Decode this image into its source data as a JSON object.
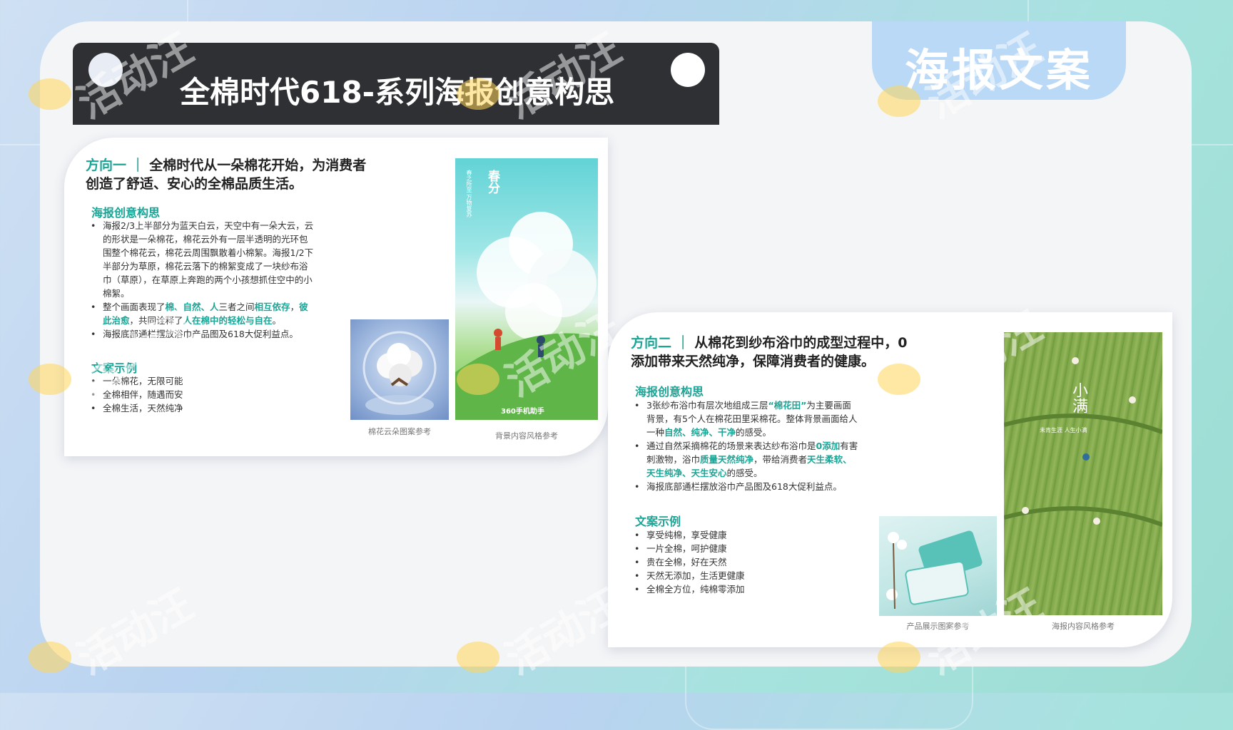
{
  "page": {
    "title": "全棉时代618-系列海报创意构思",
    "tab_label": "海报文案",
    "watermark": "活动汪"
  },
  "card1": {
    "direction_label": "方向一 ｜",
    "direction_text": "全棉时代从一朵棉花开始，为消费者创造了舒适、安心的全棉品质生活。",
    "concept_title": "海报创意构思",
    "concept_p1": "海报2/3上半部分为蓝天白云，天空中有一朵大云，云的形状是一朵棉花，棉花云外有一层半透明的光环包围整个棉花云，棉花云周围飘散着小棉絮。海报1/2下半部分为草原，棉花云落下的棉絮变成了一块纱布浴巾（草原），在草原上奔跑的两个小孩想抓住空中的小棉絮。",
    "concept_p2": {
      "t1": "整个画面表现了",
      "h1": "棉、自然、人",
      "t2": "三者之间",
      "h2": "相互依存",
      "t3": "，",
      "h3": "彼此治愈",
      "t4": "，共同诠释了",
      "h4": "人在棉中的轻松与自在",
      "t5": "。"
    },
    "concept_p3": "海报底部通栏摆放浴巾产品图及618大促利益点。",
    "copy_title": "文案示例",
    "copy_items": [
      "一朵棉花，无限可能",
      "全棉相伴，随遇而安",
      "全棉生活，天然纯净"
    ],
    "caption_left": "棉花云朵图案参考",
    "caption_right": "背景内容风格参考",
    "poster": {
      "title": "春分",
      "subtitle": "春之所至 万物复苏",
      "brand": "360手机助手"
    }
  },
  "card2": {
    "direction_label": "方向二 ｜",
    "direction_text": "从棉花到纱布浴巾的成型过程中，0添加带来天然纯净，保障消费者的健康。",
    "concept_title": "海报创意构思",
    "concept_p1": {
      "t1": "3张纱布浴巾有层次地组成三层",
      "h1": "“棉花田”",
      "t2": "为主要画面背景，有5个人在棉花田里采棉花。整体背景画面给人一种",
      "h2": "自然、纯净、干净",
      "t3": "的感受。"
    },
    "concept_p2": {
      "t1": "通过自然采摘棉花的场景来表达纱布浴巾是",
      "h1": "0添加",
      "t2": "有害刺激物，浴巾",
      "h2": "质量天然纯净",
      "t3": "，带给消费者",
      "h3": "天生柔软、天生纯净、天生安心",
      "t4": "的感受。"
    },
    "concept_p3": "海报底部通栏摆放浴巾产品图及618大促利益点。",
    "copy_title": "文案示例",
    "copy_items": [
      "享受纯棉，享受健康",
      "一片全棉，呵护健康",
      "贵在全棉，好在天然",
      "天然无添加，生活更健康",
      "全棉全方位，纯棉零添加"
    ],
    "caption_left": "产品展示图案参考",
    "caption_right": "海报内容风格参考",
    "poster": {
      "title": "小满",
      "subtitle": "未肯生涯 人生小满"
    }
  },
  "colors": {
    "accent": "#1aa596",
    "title_bar": "#2f3033",
    "tab": "#b9d9f7"
  }
}
